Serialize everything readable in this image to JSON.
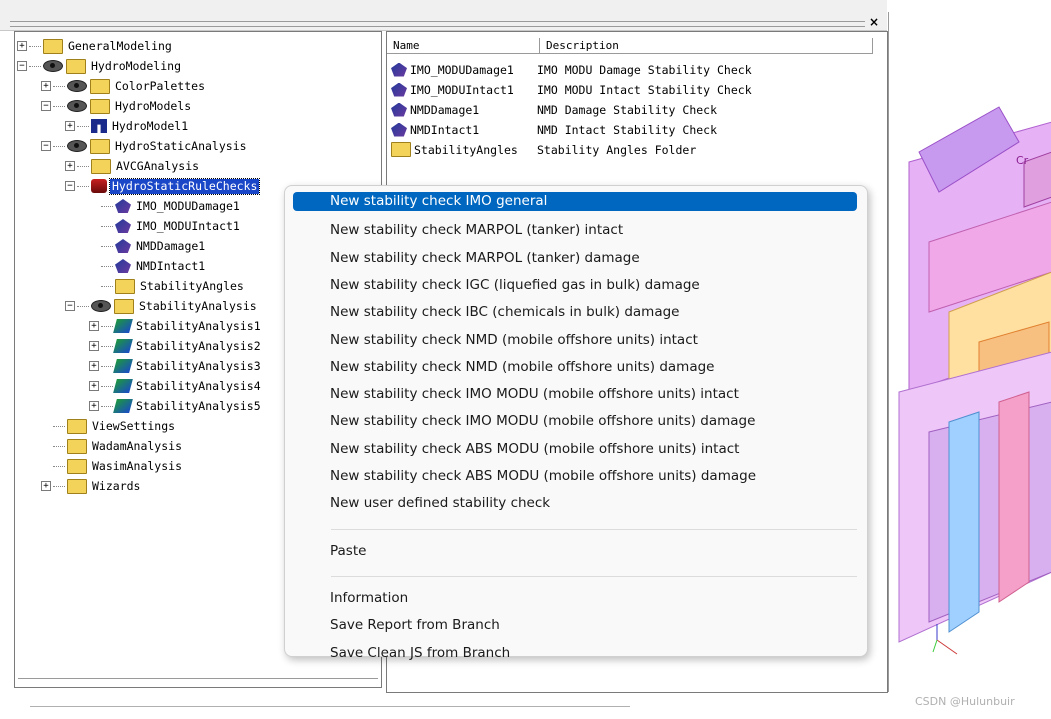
{
  "window": {
    "close_symbol": "×"
  },
  "tree": {
    "items": [
      {
        "label": "GeneralModeling",
        "expander": "+",
        "icon": "folder-icon",
        "indent": 0
      },
      {
        "label": "HydroModeling",
        "expander": "−",
        "icon": "eye-folder-icon",
        "indent": 0
      },
      {
        "label": "ColorPalettes",
        "expander": "+",
        "icon": "eye-folder-icon",
        "indent": 1
      },
      {
        "label": "HydroModels",
        "expander": "−",
        "icon": "eye-folder-icon",
        "indent": 1
      },
      {
        "label": "HydroModel1",
        "expander": "+",
        "icon": "hull-model-icon",
        "indent": 2
      },
      {
        "label": "HydroStaticAnalysis",
        "expander": "−",
        "icon": "eye-folder-icon",
        "indent": 1
      },
      {
        "label": "AVCGAnalysis",
        "expander": "+",
        "icon": "folder-icon",
        "indent": 2
      },
      {
        "label": "HydroStaticRuleChecks",
        "expander": "−",
        "icon": "rule-checks-icon",
        "indent": 2,
        "selected": true
      },
      {
        "label": "IMO_MODUDamage1",
        "expander": "",
        "icon": "stability-check-icon",
        "indent": 3
      },
      {
        "label": "IMO_MODUIntact1",
        "expander": "",
        "icon": "stability-check-icon",
        "indent": 3
      },
      {
        "label": "NMDDamage1",
        "expander": "",
        "icon": "stability-check-icon",
        "indent": 3
      },
      {
        "label": "NMDIntact1",
        "expander": "",
        "icon": "stability-check-icon",
        "indent": 3
      },
      {
        "label": "StabilityAngles",
        "expander": "",
        "icon": "angles-folder-icon",
        "indent": 3
      },
      {
        "label": "StabilityAnalysis",
        "expander": "−",
        "icon": "eye-folder-icon",
        "indent": 2
      },
      {
        "label": "StabilityAnalysis1",
        "expander": "+",
        "icon": "stability-analysis-icon",
        "indent": 3
      },
      {
        "label": "StabilityAnalysis2",
        "expander": "+",
        "icon": "stability-analysis-icon",
        "indent": 3
      },
      {
        "label": "StabilityAnalysis3",
        "expander": "+",
        "icon": "stability-analysis-icon",
        "indent": 3
      },
      {
        "label": "StabilityAnalysis4",
        "expander": "+",
        "icon": "stability-analysis-icon",
        "indent": 3
      },
      {
        "label": "StabilityAnalysis5",
        "expander": "+",
        "icon": "stability-analysis-icon",
        "indent": 3
      },
      {
        "label": "ViewSettings",
        "expander": "",
        "icon": "folder-icon",
        "indent": 1
      },
      {
        "label": "WadamAnalysis",
        "expander": "",
        "icon": "folder-icon",
        "indent": 1
      },
      {
        "label": "WasimAnalysis",
        "expander": "",
        "icon": "folder-icon",
        "indent": 1
      },
      {
        "label": "Wizards",
        "expander": "+",
        "icon": "folder-icon",
        "indent": 1
      }
    ]
  },
  "list": {
    "columns": [
      "Name",
      "Description"
    ],
    "rows": [
      {
        "name": "IMO_MODUDamage1",
        "description": "IMO MODU Damage Stability Check",
        "icon": "stability-check-icon"
      },
      {
        "name": "IMO_MODUIntact1",
        "description": "IMO MODU Intact Stability Check",
        "icon": "stability-check-icon"
      },
      {
        "name": "NMDDamage1",
        "description": "NMD Damage Stability Check",
        "icon": "stability-check-icon"
      },
      {
        "name": "NMDIntact1",
        "description": "NMD Intact Stability Check",
        "icon": "stability-check-icon"
      },
      {
        "name": "StabilityAngles",
        "description": "Stability Angles Folder",
        "icon": "angles-folder-icon"
      }
    ]
  },
  "context_menu": {
    "groups": [
      [
        "New stability check IMO general",
        "New stability check MARPOL (tanker) intact",
        "New stability check MARPOL (tanker) damage",
        "New stability check IGC (liquefied gas in bulk) damage",
        "New stability check IBC (chemicals in bulk) damage",
        "New stability check NMD (mobile offshore units) intact",
        "New stability check NMD (mobile offshore units) damage",
        "New stability check IMO MODU (mobile offshore units) intact",
        "New stability check IMO MODU (mobile offshore units) damage",
        "New stability check ABS MODU (mobile offshore units) intact",
        "New stability check ABS MODU (mobile offshore units) damage",
        "New user defined stability check"
      ],
      [
        "Paste"
      ],
      [
        "Information",
        "Save Report from Branch",
        "Save Clean JS from Branch"
      ]
    ],
    "active_item": "New stability check IMO general"
  },
  "viewport": {
    "label": "Cr"
  },
  "watermark": "CSDN @Hulunbuir",
  "colors": {
    "selection": "#1a46c8",
    "menu_highlight": "#0067c0"
  }
}
